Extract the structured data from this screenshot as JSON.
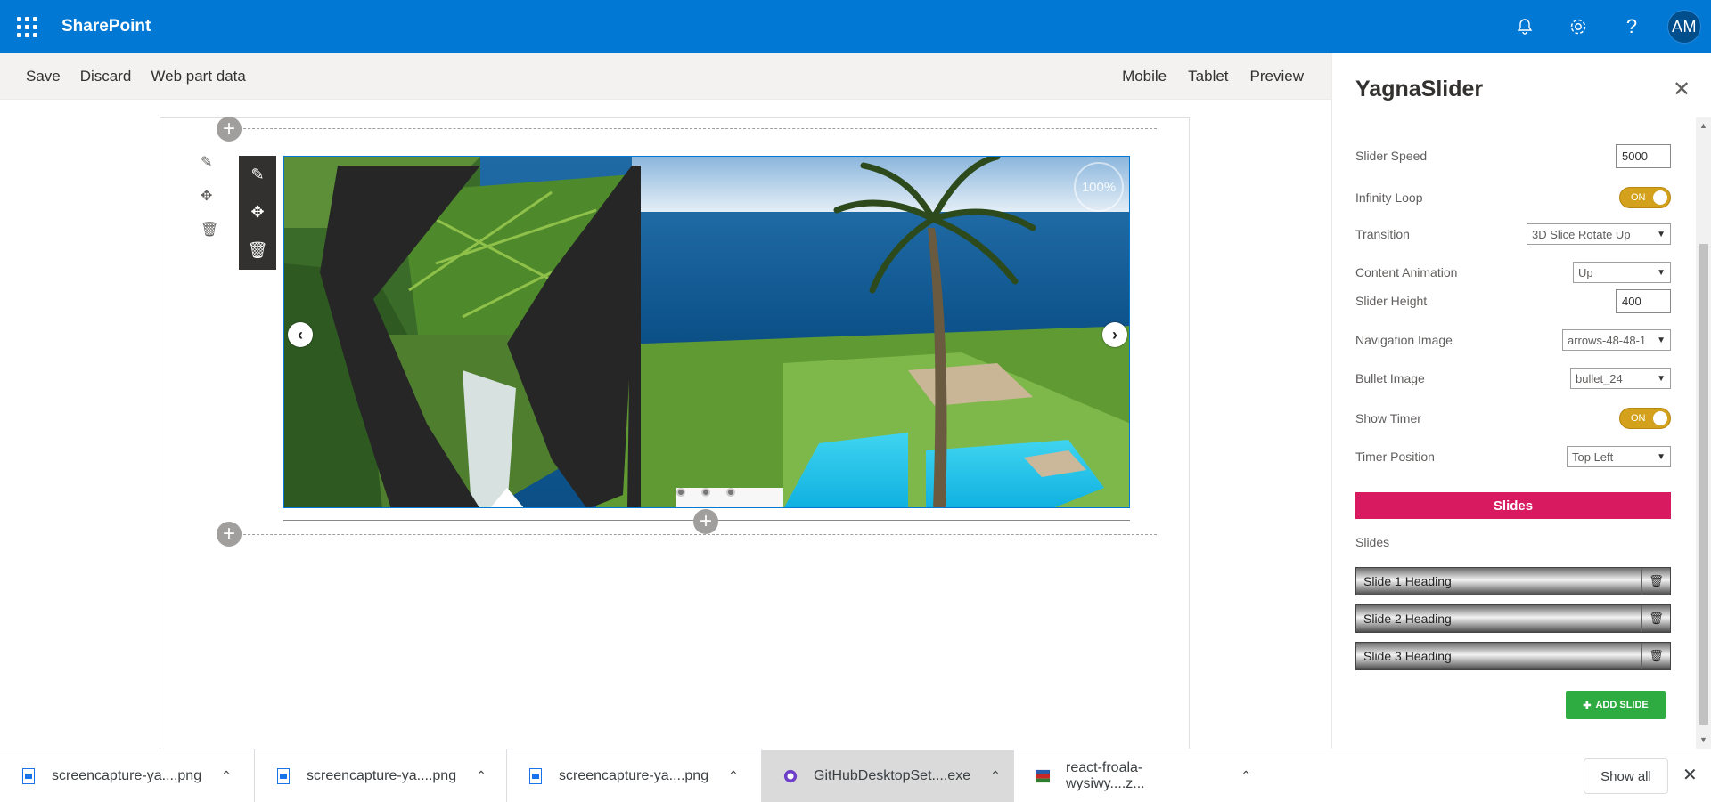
{
  "app": {
    "brand": "SharePoint",
    "avatar_initials": "AM"
  },
  "commands": {
    "save": "Save",
    "discard": "Discard",
    "webpart_data": "Web part data",
    "mobile": "Mobile",
    "tablet": "Tablet",
    "preview": "Preview"
  },
  "slider": {
    "timer_label": "100%",
    "bullet_count": 3
  },
  "pane": {
    "title": "YagnaSlider",
    "slider_speed": {
      "label": "Slider Speed",
      "value": "5000"
    },
    "infinity_loop": {
      "label": "Infinity Loop",
      "state": "ON"
    },
    "transition": {
      "label": "Transition",
      "value": "3D Slice Rotate Up"
    },
    "content_animation": {
      "label": "Content Animation",
      "value": "Up"
    },
    "slider_height": {
      "label": "Slider Height",
      "value": "400"
    },
    "navigation_image": {
      "label": "Navigation Image",
      "value": "arrows-48-48-1"
    },
    "bullet_image": {
      "label": "Bullet Image",
      "value": "bullet_24"
    },
    "show_timer": {
      "label": "Show Timer",
      "state": "ON"
    },
    "timer_position": {
      "label": "Timer Position",
      "value": "Top Left"
    },
    "slides_header": "Slides",
    "slides_label": "Slides",
    "slides": [
      {
        "name": "Slide 1 Heading"
      },
      {
        "name": "Slide 2 Heading"
      },
      {
        "name": "Slide 3 Heading"
      }
    ],
    "add_slide": "ADD SLIDE"
  },
  "downloads": {
    "items": [
      {
        "name": "screencapture-ya....png",
        "icon": "image-file-icon"
      },
      {
        "name": "screencapture-ya....png",
        "icon": "image-file-icon"
      },
      {
        "name": "screencapture-ya....png",
        "icon": "image-file-icon"
      },
      {
        "name": "GitHubDesktopSet....exe",
        "icon": "github-desktop-icon"
      },
      {
        "name": "react-froala-wysiwy....z...",
        "icon": "archive-file-icon"
      }
    ],
    "show_all": "Show all"
  },
  "colors": {
    "suite_bar": "#0078d4",
    "slides_header": "#d81b60",
    "add_slide": "#2eac41",
    "toggle_on": "#d3a11b"
  }
}
